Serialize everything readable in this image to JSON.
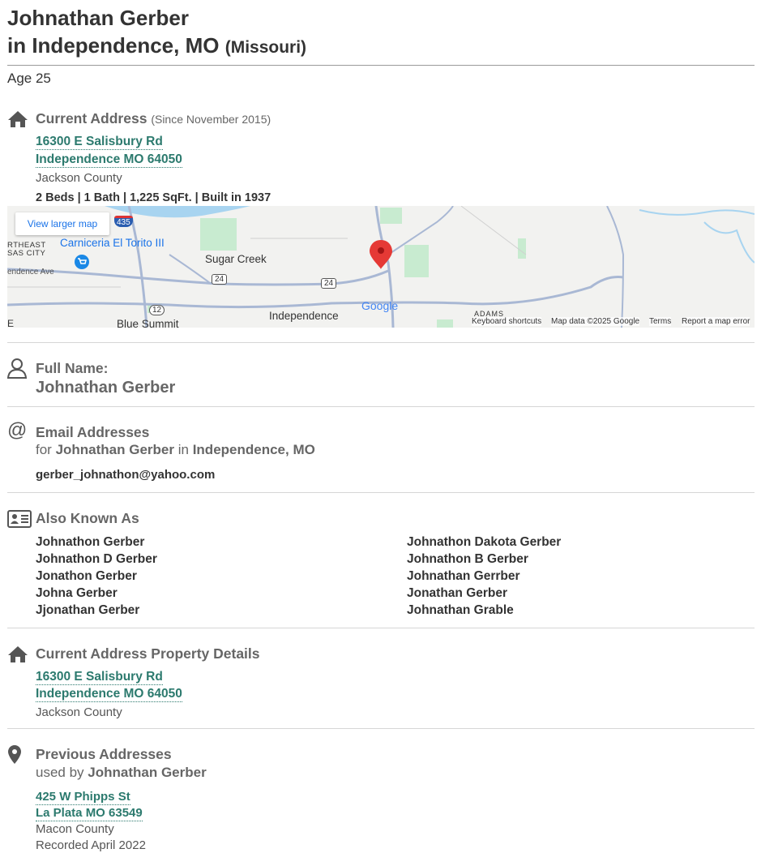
{
  "header": {
    "name": "Johnathan Gerber",
    "location_prefix": "in Independence, MO",
    "state": "(Missouri)",
    "age": "Age 25"
  },
  "current_address": {
    "title": "Current Address",
    "since": "(Since November 2015)",
    "street": "16300 E Salisbury Rd",
    "city": "Independence MO 64050",
    "county": "Jackson County",
    "specs": "2 Beds | 1 Bath | 1,225 SqFt. | Built in 1937"
  },
  "map": {
    "view_larger": "View larger map",
    "labels": {
      "northeast": "RTHEAST",
      "city": "SAS CITY",
      "carniceria": "Carniceria El Torito III",
      "sugar_creek": "Sugar Creek",
      "independence_ave": "endence Ave",
      "independence": "Independence",
      "blue_summit": "Blue Summit",
      "adams": "ADAMS",
      "e_edge": "E",
      "shield_24a": "24",
      "shield_24b": "24",
      "shield_12": "12",
      "shield_435": "435",
      "google": "Google"
    },
    "footer": {
      "shortcuts": "Keyboard shortcuts",
      "data": "Map data ©2025 Google",
      "terms": "Terms",
      "report": "Report a map error"
    },
    "colors": {
      "road": "#a9b8d4",
      "park": "#c8ebd0",
      "water": "#a8d4f0",
      "pin": "#e53935"
    }
  },
  "full_name": {
    "title": "Full Name:",
    "value": "Johnathan Gerber"
  },
  "email": {
    "title": "Email Addresses",
    "for": "for",
    "name": "Johnathan Gerber",
    "in": "in",
    "place": "Independence, MO",
    "address": "gerber_johnathon@yahoo.com"
  },
  "aka": {
    "title": "Also Known As",
    "left": [
      "Johnathon Gerber",
      "Johnathon D Gerber",
      "Jonathon Gerber",
      "Johna Gerber",
      "Jjonathan Gerber"
    ],
    "right": [
      "Johnathon Dakota Gerber",
      "Johnathon B Gerber",
      "Johnathan Gerrber",
      "Jonathan Gerber",
      "Johnathan Grable"
    ]
  },
  "property": {
    "title": "Current Address Property Details",
    "street": "16300 E Salisbury Rd",
    "city": "Independence MO 64050",
    "county": "Jackson County"
  },
  "previous": {
    "title": "Previous Addresses",
    "used_by": "used by",
    "name": "Johnathan Gerber",
    "street": "425 W Phipps St",
    "city": "La Plata MO 63549",
    "county": "Macon County",
    "recorded": "Recorded April 2022"
  }
}
